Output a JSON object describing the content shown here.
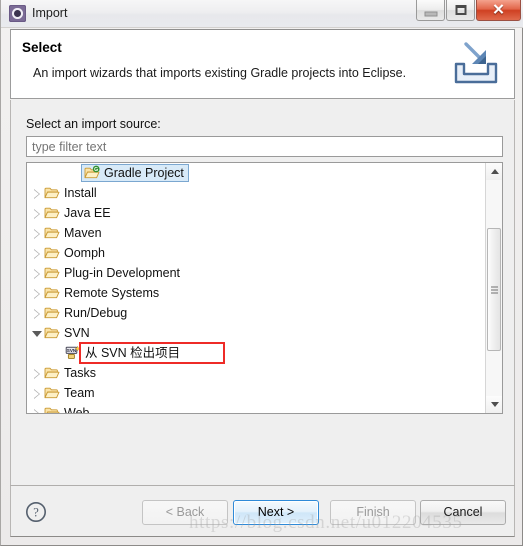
{
  "window": {
    "title": "Import",
    "icon": "import-wizard-icon",
    "controls": {
      "minimize": "minimize-button",
      "maximize": "maximize-button",
      "close": "close-button",
      "close_glyph": "✕"
    }
  },
  "banner": {
    "title": "Select",
    "description": "An import wizards that imports existing Gradle projects into Eclipse.",
    "icon": "import-banner-icon"
  },
  "page": {
    "source_label": "Select an import source:",
    "filter": {
      "value": "",
      "placeholder": "type filter text"
    }
  },
  "tree": {
    "items": [
      {
        "label": "Gradle Project",
        "icon": "gradle-folder-icon",
        "level": 1,
        "state": "leaf",
        "selected": true
      },
      {
        "label": "Install",
        "icon": "folder-icon",
        "level": 0,
        "state": "collapsed",
        "selected": false
      },
      {
        "label": "Java EE",
        "icon": "folder-icon",
        "level": 0,
        "state": "collapsed",
        "selected": false
      },
      {
        "label": "Maven",
        "icon": "folder-icon",
        "level": 0,
        "state": "collapsed",
        "selected": false
      },
      {
        "label": "Oomph",
        "icon": "folder-icon",
        "level": 0,
        "state": "collapsed",
        "selected": false
      },
      {
        "label": "Plug-in Development",
        "icon": "folder-icon",
        "level": 0,
        "state": "collapsed",
        "selected": false
      },
      {
        "label": "Remote Systems",
        "icon": "folder-icon",
        "level": 0,
        "state": "collapsed",
        "selected": false
      },
      {
        "label": "Run/Debug",
        "icon": "folder-icon",
        "level": 0,
        "state": "collapsed",
        "selected": false
      },
      {
        "label": "SVN",
        "icon": "folder-icon",
        "level": 0,
        "state": "expanded",
        "selected": false
      },
      {
        "label": "从 SVN 检出项目",
        "icon": "svn-checkout-icon",
        "level": 1,
        "state": "leaf",
        "selected": false,
        "highlighted": true
      },
      {
        "label": "Tasks",
        "icon": "folder-icon",
        "level": 0,
        "state": "collapsed",
        "selected": false
      },
      {
        "label": "Team",
        "icon": "folder-icon",
        "level": 0,
        "state": "collapsed",
        "selected": false
      },
      {
        "label": "Web",
        "icon": "folder-icon",
        "level": 0,
        "state": "collapsed",
        "selected": false
      }
    ],
    "scrollbar": {
      "up_arrow": "scroll-up-arrow",
      "down_arrow": "scroll-down-arrow",
      "thumb": "scroll-thumb"
    }
  },
  "buttons": {
    "help": "?",
    "back": "< Back",
    "next": "Next >",
    "finish": "Finish",
    "cancel": "Cancel"
  },
  "annotation": {
    "highlight_color": "#ee2b27",
    "watermark": "https://blog.csdn.net/u012204535"
  }
}
